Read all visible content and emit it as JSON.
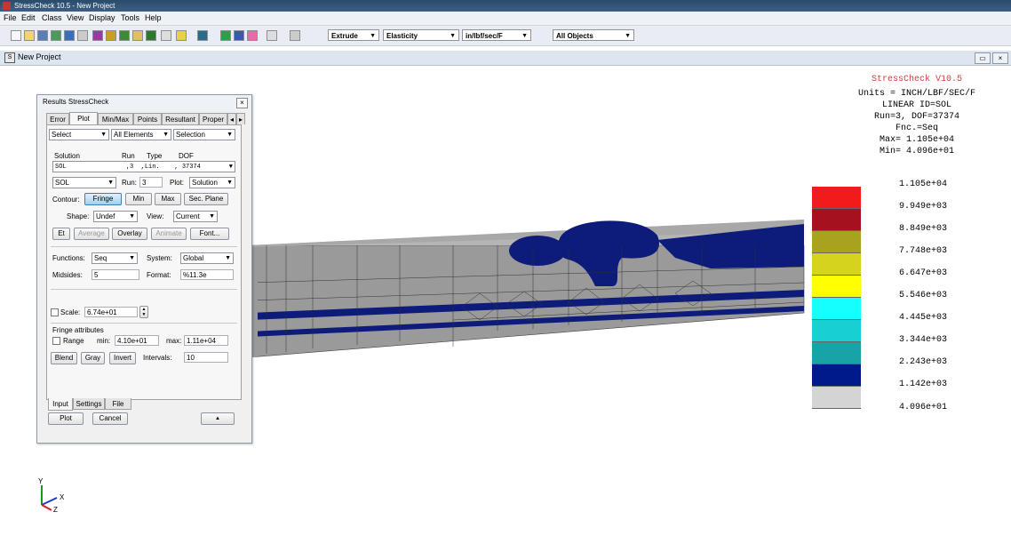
{
  "window": {
    "title": "StressCheck 10.5 - New Project"
  },
  "menu": [
    "File",
    "Edit",
    "Class",
    "View",
    "Display",
    "Tools",
    "Help"
  ],
  "toolbar": {
    "dropdowns": [
      "Extrude",
      "Elasticity",
      "in/lbf/sec/F",
      "All Objects"
    ]
  },
  "child_window": {
    "title": "New Project"
  },
  "info": {
    "product": "StressCheck V10.5",
    "lines": [
      "Units = INCH/LBF/SEC/F",
      "LINEAR ID=SOL",
      "Run=3, DOF=37374",
      "Fnc.=Seq",
      "Max=  1.105e+04",
      "Min=  4.096e+01"
    ]
  },
  "legend": {
    "values": [
      "1.105e+04",
      "9.949e+03",
      "8.849e+03",
      "7.748e+03",
      "6.647e+03",
      "5.546e+03",
      "4.445e+03",
      "3.344e+03",
      "2.243e+03",
      "1.142e+03",
      "4.096e+01"
    ],
    "colors": [
      "#f21b1b",
      "#a5111f",
      "#a7a31c",
      "#d6d31e",
      "#ffff00",
      "#16ffff",
      "#18cfd3",
      "#18a3a6",
      "#001a8c",
      "#d4d4d4"
    ]
  },
  "dialog": {
    "title": "Results StressCheck",
    "tabs": [
      "Error",
      "Plot",
      "Min/Max",
      "Points",
      "Resultant",
      "Proper"
    ],
    "row1": [
      "Select",
      "All Elements",
      "Selection"
    ],
    "solution_headers": [
      "Solution",
      "Run",
      "Type",
      "DOF"
    ],
    "solution_row": "SOL                ,3  ,Lin.    , 37374",
    "sol_select": "SOL",
    "run_label": "Run:",
    "run_value": "3",
    "plot_label": "Plot:",
    "plot_value": "Solution",
    "contour_label": "Contour:",
    "contour_buttons": [
      "Fringe",
      "Min",
      "Max",
      "Sec. Plane"
    ],
    "shape_label": "Shape:",
    "shape_value": "Undef",
    "view_label": "View:",
    "view_value": "Current",
    "action_buttons": [
      "Et",
      "Average",
      "Overlay",
      "Animate",
      "Font..."
    ],
    "functions_label": "Functions:",
    "functions_value": "Seq",
    "system_label": "System:",
    "system_value": "Global",
    "midsides_label": "Midsides:",
    "midsides_value": "5",
    "format_label": "Format:",
    "format_value": "%11.3e",
    "scale_label": "Scale:",
    "scale_value": "6.74e+01",
    "fringe_attr_label": "Fringe attributes",
    "range_label": "Range",
    "min_label": "min:",
    "min_value": "4.10e+01",
    "max_label": "max:",
    "max_value": "1.11e+04",
    "blend_buttons": [
      "Blend",
      "Gray",
      "Invert"
    ],
    "intervals_label": "Intervals:",
    "intervals_value": "10",
    "bottom_tabs": [
      "Input",
      "Settings",
      "File"
    ],
    "plot_button": "Plot",
    "cancel_button": "Cancel",
    "collapse_button": "▲"
  },
  "axes": {
    "x": "X",
    "y": "Y",
    "z": "Z"
  }
}
